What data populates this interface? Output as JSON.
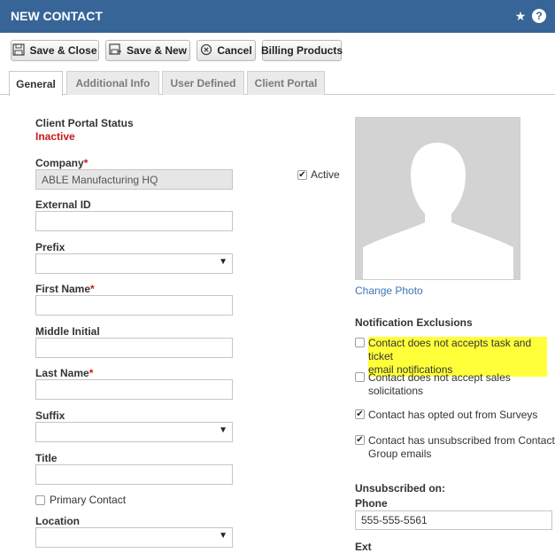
{
  "header": {
    "title": "NEW CONTACT",
    "star_icon": "star-icon",
    "help_icon": "help-icon"
  },
  "toolbar": {
    "save_close": "Save & Close",
    "save_new": "Save & New",
    "cancel": "Cancel",
    "billing": "Billing Products"
  },
  "tabs": [
    {
      "label": "General",
      "active": true
    },
    {
      "label": "Additional Info",
      "active": false
    },
    {
      "label": "User Defined",
      "active": false
    },
    {
      "label": "Client Portal",
      "active": false
    }
  ],
  "form": {
    "portal_status_label": "Client Portal Status",
    "portal_status_value": "Inactive",
    "company_label": "Company",
    "company_value": "ABLE Manufacturing HQ",
    "active_label": "Active",
    "external_id_label": "External ID",
    "prefix_label": "Prefix",
    "first_name_label": "First Name",
    "middle_initial_label": "Middle Initial",
    "last_name_label": "Last Name",
    "suffix_label": "Suffix",
    "title_label": "Title",
    "primary_contact_label": "Primary Contact",
    "location_label": "Location",
    "required_mark": "*"
  },
  "photo": {
    "change_link": "Change Photo"
  },
  "notifications": {
    "heading": "Notification Exclusions",
    "items": [
      {
        "line1": "Contact does not accepts task and ticket",
        "line2": "email notifications",
        "checked": false,
        "highlight": true
      },
      {
        "line1": "Contact does not accept sales",
        "line2": "solicitations",
        "checked": false,
        "highlight": false
      },
      {
        "line1": "Contact has opted out from Surveys",
        "line2": "",
        "checked": true,
        "highlight": false
      },
      {
        "line1": "Contact has unsubscribed from Contact",
        "line2": "Group emails",
        "checked": true,
        "highlight": false
      }
    ],
    "unsubscribed_label": "Unsubscribed on:",
    "phone_label": "Phone",
    "phone_value": "555-555-5561",
    "ext_label": "Ext"
  },
  "colors": {
    "header_bg": "#376597",
    "required": "#d01818",
    "highlight": "#ffff3a",
    "link": "#3d77b7"
  }
}
